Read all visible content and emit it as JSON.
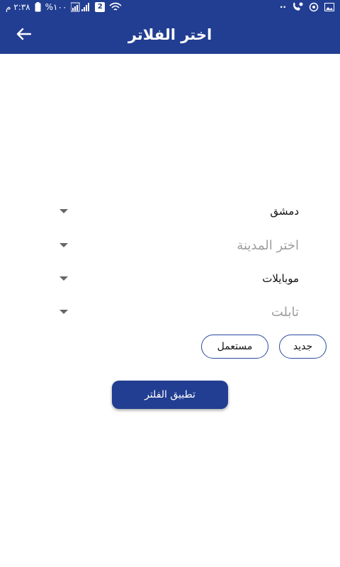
{
  "status_bar": {
    "time": "٢:٣٨ م",
    "battery": "%١٠٠",
    "sim_badge": "2",
    "notif_dots": "··"
  },
  "app_bar": {
    "title": "اختر الفلاتر",
    "back_icon": "arrow-left-icon"
  },
  "filters": {
    "governorate": {
      "value": "دمشق"
    },
    "city": {
      "placeholder": "اختر المدينة"
    },
    "category": {
      "value": "موبايلات"
    },
    "subcategory": {
      "placeholder": "تابلت"
    }
  },
  "condition": {
    "new_label": "جديد",
    "used_label": "مستعمل"
  },
  "apply_button": {
    "label": "تطبيق الفلتر"
  },
  "colors": {
    "primary": "#223e92",
    "chip_border": "#2a4aa0",
    "placeholder": "#9e9e9e"
  }
}
